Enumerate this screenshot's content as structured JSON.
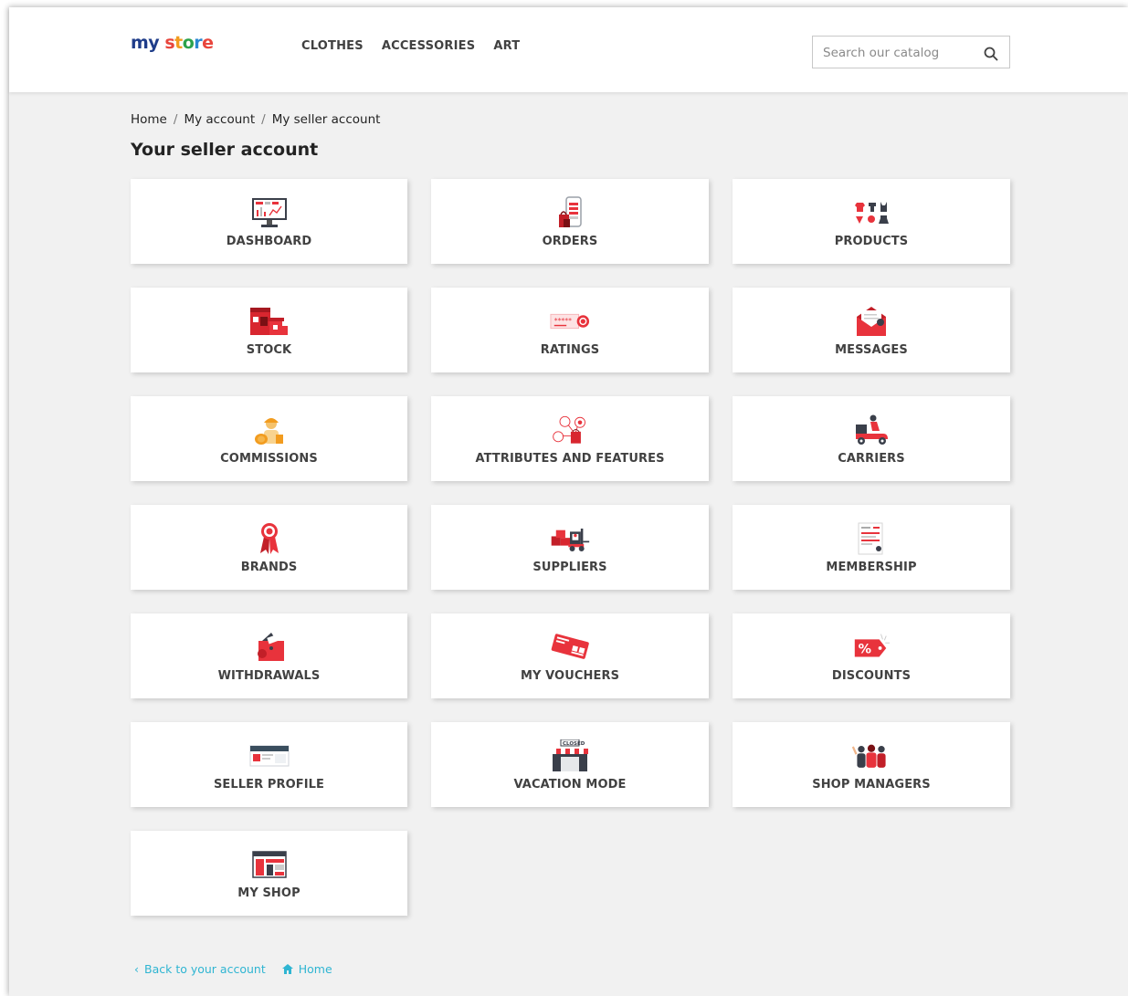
{
  "logo": {
    "my": "my",
    "store": [
      "s",
      "t",
      "o",
      "r",
      "e"
    ]
  },
  "nav": {
    "items": [
      "CLOTHES",
      "ACCESSORIES",
      "ART"
    ]
  },
  "search": {
    "placeholder": "Search our catalog",
    "icon": "search-icon"
  },
  "breadcrumb": {
    "items": [
      "Home",
      "My account",
      "My seller account"
    ],
    "separator": "/"
  },
  "page": {
    "title": "Your seller account"
  },
  "cards": [
    {
      "label": "DASHBOARD",
      "icon": "dashboard-icon"
    },
    {
      "label": "ORDERS",
      "icon": "orders-icon"
    },
    {
      "label": "PRODUCTS",
      "icon": "products-icon"
    },
    {
      "label": "STOCK",
      "icon": "stock-icon"
    },
    {
      "label": "RATINGS",
      "icon": "ratings-icon"
    },
    {
      "label": "MESSAGES",
      "icon": "messages-icon"
    },
    {
      "label": "COMMISSIONS",
      "icon": "commissions-icon"
    },
    {
      "label": "ATTRIBUTES AND FEATURES",
      "icon": "attributes-icon"
    },
    {
      "label": "CARRIERS",
      "icon": "carriers-icon"
    },
    {
      "label": "BRANDS",
      "icon": "brands-icon"
    },
    {
      "label": "SUPPLIERS",
      "icon": "suppliers-icon"
    },
    {
      "label": "MEMBERSHIP",
      "icon": "membership-icon"
    },
    {
      "label": "WITHDRAWALS",
      "icon": "withdrawals-icon"
    },
    {
      "label": "MY VOUCHERS",
      "icon": "vouchers-icon"
    },
    {
      "label": "DISCOUNTS",
      "icon": "discounts-icon"
    },
    {
      "label": "SELLER PROFILE",
      "icon": "seller-profile-icon"
    },
    {
      "label": "VACATION MODE",
      "icon": "vacation-mode-icon",
      "icon_text": "CLOSED"
    },
    {
      "label": "SHOP MANAGERS",
      "icon": "shop-managers-icon"
    },
    {
      "label": "MY SHOP",
      "icon": "my-shop-icon"
    }
  ],
  "footer_links": {
    "back": "Back to your account",
    "home": "Home"
  },
  "colors": {
    "accent": "#e8333c",
    "link": "#2fb5d2",
    "text": "#414141"
  }
}
